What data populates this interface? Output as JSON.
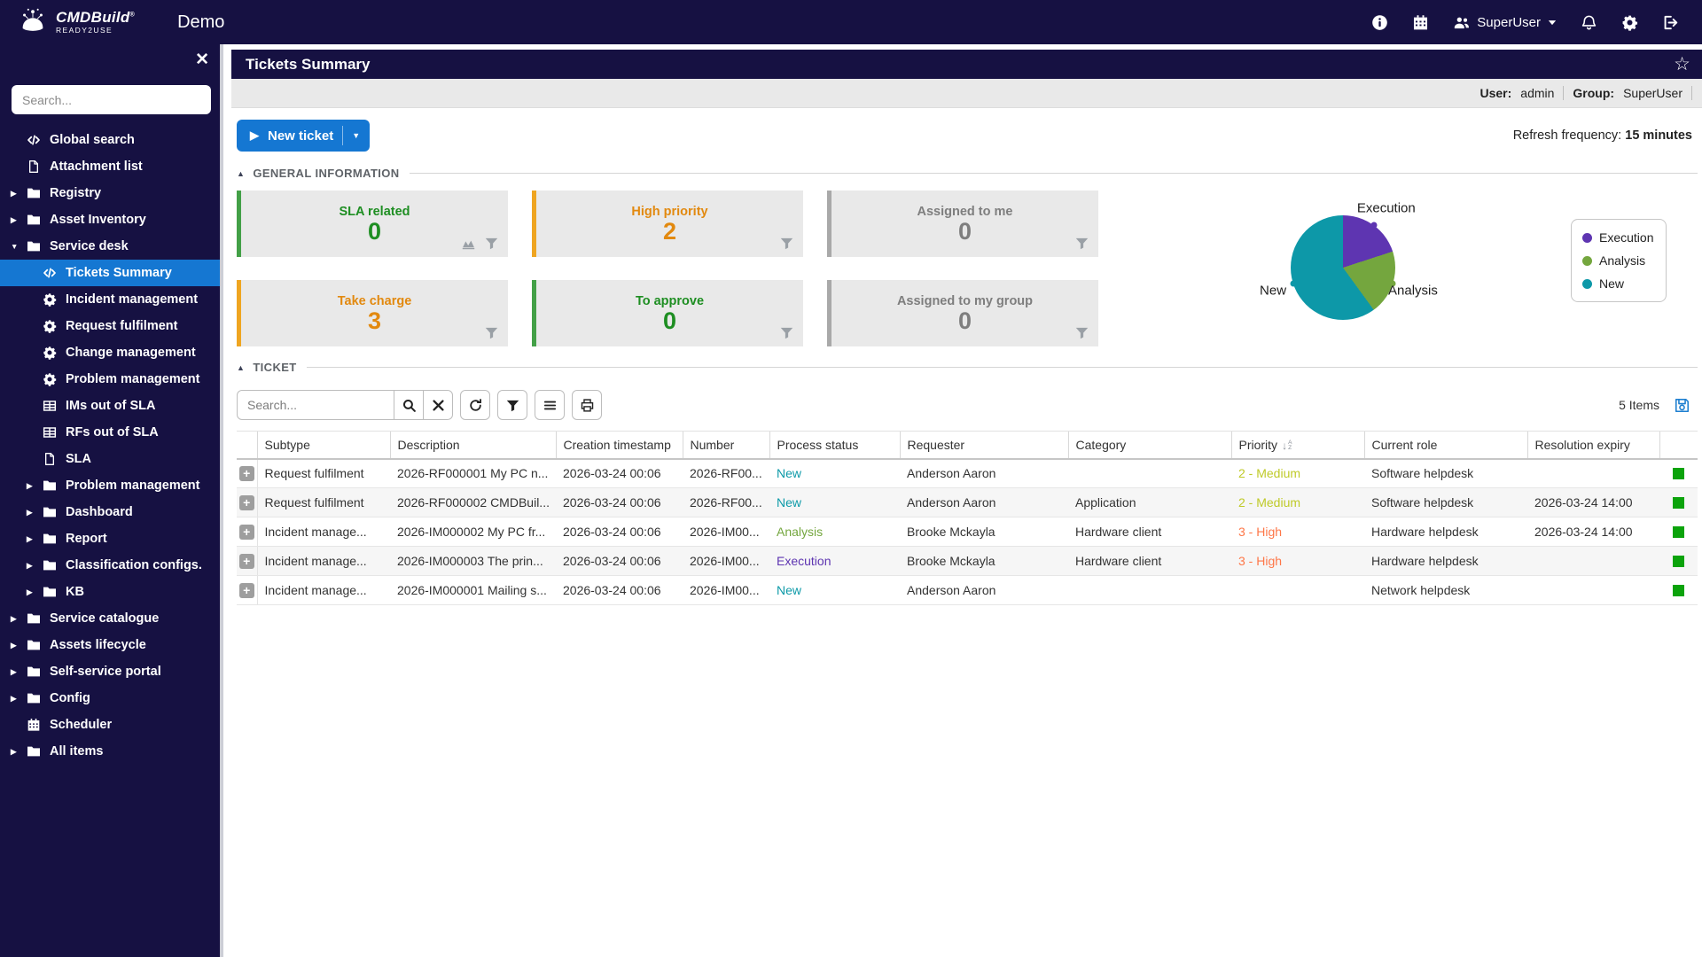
{
  "header": {
    "logo_line1": "CMDBuild",
    "logo_reg": "®",
    "logo_line2": "READY2USE",
    "app_title": "Demo",
    "actions": [
      {
        "icon": "info"
      },
      {
        "icon": "calendar"
      },
      {
        "type": "user",
        "label": "SuperUser"
      },
      {
        "icon": "bell"
      },
      {
        "icon": "gear"
      },
      {
        "icon": "sign-out"
      }
    ]
  },
  "sidebar": {
    "search_placeholder": "Search...",
    "items": [
      {
        "label": "Global search",
        "icon": "code",
        "level": 0
      },
      {
        "label": "Attachment list",
        "icon": "file",
        "level": 0
      },
      {
        "label": "Registry",
        "icon": "folder",
        "arrow": "collapsed",
        "level": 0
      },
      {
        "label": "Asset Inventory",
        "icon": "folder",
        "arrow": "collapsed",
        "level": 0
      },
      {
        "label": "Service desk",
        "icon": "folder",
        "arrow": "expanded",
        "level": 0
      },
      {
        "label": "Tickets Summary",
        "icon": "code",
        "level": 1,
        "selected": true
      },
      {
        "label": "Incident management",
        "icon": "gear",
        "level": 1
      },
      {
        "label": "Request fulfilment",
        "icon": "gear",
        "level": 1
      },
      {
        "label": "Change management",
        "icon": "gear",
        "level": 1
      },
      {
        "label": "Problem management",
        "icon": "gear",
        "level": 1
      },
      {
        "label": "IMs out of SLA",
        "icon": "table",
        "level": 1
      },
      {
        "label": "RFs out of SLA",
        "icon": "table",
        "level": 1
      },
      {
        "label": "SLA",
        "icon": "file",
        "level": 1
      },
      {
        "label": "Problem management",
        "icon": "folder",
        "arrow": "collapsed",
        "level": 1
      },
      {
        "label": "Dashboard",
        "icon": "folder",
        "arrow": "collapsed",
        "level": 1
      },
      {
        "label": "Report",
        "icon": "folder",
        "arrow": "collapsed",
        "level": 1
      },
      {
        "label": "Classification configs.",
        "icon": "folder",
        "arrow": "collapsed",
        "level": 1
      },
      {
        "label": "KB",
        "icon": "folder",
        "arrow": "collapsed",
        "level": 1
      },
      {
        "label": "Service catalogue",
        "icon": "folder",
        "arrow": "collapsed",
        "level": 0
      },
      {
        "label": "Assets lifecycle",
        "icon": "folder",
        "arrow": "collapsed",
        "level": 0
      },
      {
        "label": "Self-service portal",
        "icon": "folder",
        "arrow": "collapsed",
        "level": 0
      },
      {
        "label": "Config",
        "icon": "folder",
        "arrow": "collapsed",
        "level": 0
      },
      {
        "label": "Scheduler",
        "icon": "calendar",
        "level": 0
      },
      {
        "label": "All items",
        "icon": "folder",
        "arrow": "collapsed",
        "level": 0
      }
    ]
  },
  "page": {
    "title": "Tickets Summary",
    "user_label": "User:",
    "user_value": "admin",
    "group_label": "Group:",
    "group_value": "SuperUser",
    "new_ticket_label": "New ticket",
    "refresh_label": "Refresh frequency:",
    "refresh_value": "15 minutes"
  },
  "general_info": {
    "section_title": "GENERAL INFORMATION",
    "card_colors": {
      "green": {
        "border": "#43a047",
        "text": "#1e8e22"
      },
      "orange": {
        "border": "#efa521",
        "text": "#e2890f"
      },
      "gray": {
        "border": "#a9a9a9",
        "text": "#7e7e7e"
      }
    },
    "cards": [
      {
        "label": "SLA related",
        "value": "0",
        "color": "green",
        "chart_icon": true
      },
      {
        "label": "High priority",
        "value": "2",
        "color": "orange"
      },
      {
        "label": "Assigned to me",
        "value": "0",
        "color": "gray"
      },
      {
        "label": "Take charge",
        "value": "3",
        "color": "orange"
      },
      {
        "label": "To approve",
        "value": "0",
        "color": "green"
      },
      {
        "label": "Assigned to my group",
        "value": "0",
        "color": "gray"
      }
    ]
  },
  "chart_data": {
    "type": "pie",
    "title": "",
    "slices": [
      {
        "label": "Execution",
        "value": 1,
        "color": "#5e35b1"
      },
      {
        "label": "Analysis",
        "value": 1,
        "color": "#74a63e"
      },
      {
        "label": "New",
        "value": 3,
        "color": "#0d98a8"
      }
    ],
    "legend": [
      "Execution",
      "Analysis",
      "New"
    ],
    "legend_position": "right"
  },
  "ticket": {
    "section_title": "TICKET",
    "search_placeholder": "Search...",
    "items_count": "5 Items",
    "columns": [
      "Subtype",
      "Description",
      "Creation timestamp",
      "Number",
      "Process status",
      "Requester",
      "Category",
      "Priority",
      "Current role",
      "Resolution expiry"
    ],
    "sorted_column": "Priority",
    "status_colors": {
      "New": "#0d9aa8",
      "Analysis": "#74a63e",
      "Execution": "#5e35b1"
    },
    "priority_colors": {
      "2 - Medium": "#bfca28",
      "3 - High": "#fe7748"
    },
    "row_flag_color": "#0ba30b",
    "rows": [
      {
        "subtype": "Request fulfilment",
        "description": "2026-RF000001 My PC n...",
        "created": "2026-03-24 00:06",
        "number": "2026-RF00...",
        "status": "New",
        "requester": "Anderson Aaron",
        "category": "",
        "priority": "2 - Medium",
        "role": "Software helpdesk",
        "expiry": ""
      },
      {
        "subtype": "Request fulfilment",
        "description": "2026-RF000002 CMDBuil...",
        "created": "2026-03-24 00:06",
        "number": "2026-RF00...",
        "status": "New",
        "requester": "Anderson Aaron",
        "category": "Application",
        "priority": "2 - Medium",
        "role": "Software helpdesk",
        "expiry": "2026-03-24 14:00"
      },
      {
        "subtype": "Incident manage...",
        "description": "2026-IM000002 My PC fr...",
        "created": "2026-03-24 00:06",
        "number": "2026-IM00...",
        "status": "Analysis",
        "requester": "Brooke Mckayla",
        "category": "Hardware client",
        "priority": "3 - High",
        "role": "Hardware helpdesk",
        "expiry": "2026-03-24 14:00"
      },
      {
        "subtype": "Incident manage...",
        "description": "2026-IM000003 The prin...",
        "created": "2026-03-24 00:06",
        "number": "2026-IM00...",
        "status": "Execution",
        "requester": "Brooke Mckayla",
        "category": "Hardware client",
        "priority": "3 - High",
        "role": "Hardware helpdesk",
        "expiry": ""
      },
      {
        "subtype": "Incident manage...",
        "description": "2026-IM000001 Mailing s...",
        "created": "2026-03-24 00:06",
        "number": "2026-IM00...",
        "status": "New",
        "requester": "Anderson Aaron",
        "category": "",
        "priority": "",
        "role": "Network helpdesk",
        "expiry": ""
      }
    ]
  }
}
